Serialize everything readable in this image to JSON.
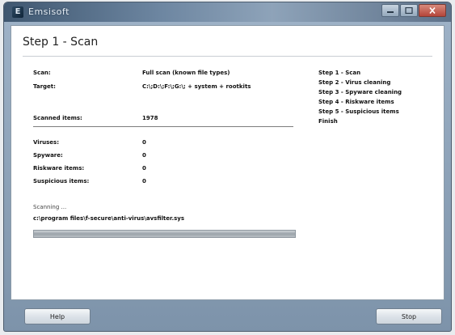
{
  "window": {
    "title": "Emsisoft",
    "icon": "app-icon"
  },
  "header": {
    "title": "Step 1 - Scan"
  },
  "scan_info": {
    "scan_label": "Scan:",
    "scan_value": "Full scan (known file types)",
    "target_label": "Target:",
    "target_value": "C:\\;D:\\;F:\\;G:\\; + system + rootkits",
    "scanned_label": "Scanned items:",
    "scanned_value": "1978"
  },
  "results": {
    "viruses_label": "Viruses:",
    "viruses_value": "0",
    "spyware_label": "Spyware:",
    "spyware_value": "0",
    "riskware_label": "Riskware items:",
    "riskware_value": "0",
    "suspicious_label": "Suspicious items:",
    "suspicious_value": "0"
  },
  "steps": [
    "Step 1 - Scan",
    "Step 2 - Virus cleaning",
    "Step 3 - Spyware cleaning",
    "Step 4 - Riskware items",
    "Step 5 - Suspicious items",
    "Finish"
  ],
  "progress": {
    "status_label": "Scanning ...",
    "current_file": "c:\\program files\\f-secure\\anti-virus\\avsfilter.sys",
    "fraction": 1.0
  },
  "buttons": {
    "help": "Help",
    "stop": "Stop"
  },
  "colors": {
    "titlebar": "#3f5770",
    "frame": "#9fb3c8",
    "progress": "#9aa2a9"
  }
}
